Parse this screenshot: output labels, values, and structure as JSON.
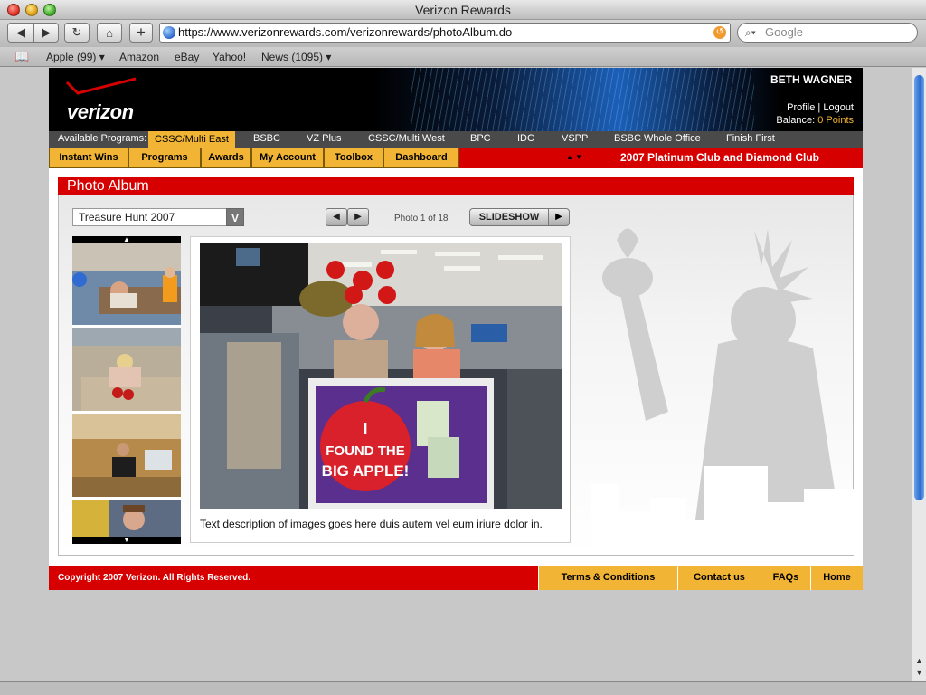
{
  "window": {
    "title": "Verizon Rewards"
  },
  "browser": {
    "url": "https://www.verizonrewards.com/verizonrewards/photoAlbum.do",
    "search_placeholder": "Google",
    "back_icon": "◀",
    "forward_icon": "▶",
    "reload_icon": "↻",
    "home_icon": "⌂",
    "add_icon": "+",
    "bookmarks": [
      "Apple (99) ▾",
      "Amazon",
      "eBay",
      "Yahoo!",
      "News (1095) ▾"
    ]
  },
  "header": {
    "logo_text": "verizon",
    "user_name": "BETH WAGNER",
    "profile_link": "Profile",
    "link_separator": "|",
    "logout_link": "Logout",
    "balance_label": "Balance:",
    "balance_value": "0 Points"
  },
  "programs": {
    "label": "Available Programs:",
    "items": [
      "CSSC/Multi East",
      "BSBC",
      "VZ Plus",
      "CSSC/Multi West",
      "BPC",
      "IDC",
      "VSPP",
      "BSBC Whole Office",
      "Finish First"
    ],
    "active_index": 0
  },
  "nav": {
    "items": [
      "Instant Wins",
      "Programs",
      "Awards",
      "My Account",
      "Toolbox",
      "Dashboard"
    ],
    "arrows": "▲ ▼",
    "program_title": "2007 Platinum Club and Diamond Club"
  },
  "album": {
    "title": "Photo Album",
    "selected_album": "Treasure Hunt 2007",
    "select_caret": "V",
    "prev_icon": "◀",
    "next_icon": "▶",
    "photo_counter": "Photo 1 of 18",
    "slideshow_label": "SLIDESHOW",
    "play_icon": "▶",
    "thumb_up_icon": "▲",
    "thumb_down_icon": "▼",
    "caption": "Text description of images goes here duis autem vel eum iriure dolor in.",
    "sign_text_1": "I",
    "sign_text_2": "FOUND THE",
    "sign_text_3": "BIG APPLE!"
  },
  "footer": {
    "copyright": "Copyright 2007 Verizon. All Rights Reserved.",
    "links": [
      "Terms & Conditions",
      "Contact us",
      "FAQs",
      "Home"
    ]
  },
  "colors": {
    "brand_red": "#d70000",
    "accent_gold": "#f1b434",
    "header_black": "#000000"
  }
}
